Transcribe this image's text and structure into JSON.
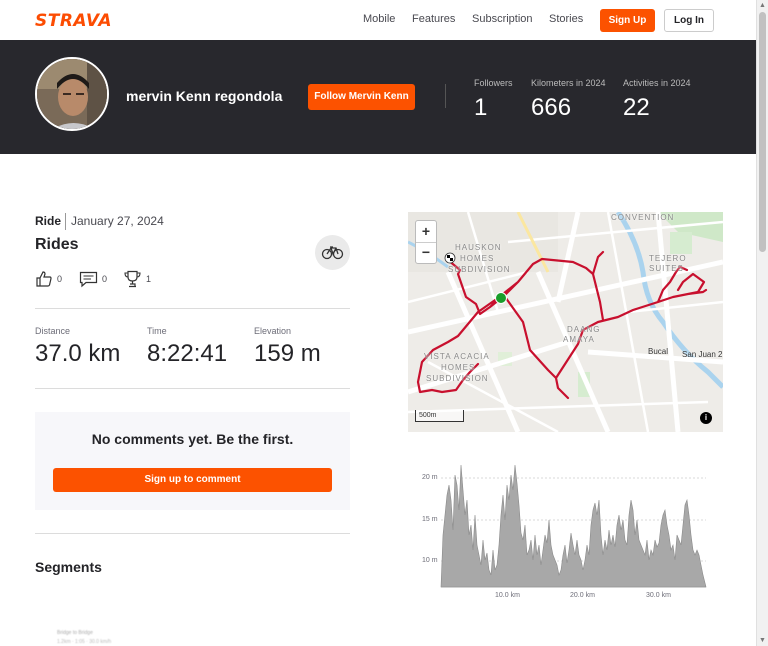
{
  "nav": {
    "logo": "STRAVA",
    "links": [
      "Mobile",
      "Features",
      "Subscription",
      "Stories"
    ],
    "signup": "Sign Up",
    "login": "Log In"
  },
  "athlete": {
    "name": "mervin Kenn regondola",
    "follow": "Follow Mervin Kenn",
    "stats": [
      {
        "label": "Followers",
        "value": "1"
      },
      {
        "label": "Kilometers in 2024",
        "value": "666"
      },
      {
        "label": "Activities in 2024",
        "value": "22"
      }
    ]
  },
  "activity": {
    "type": "Ride",
    "date": "January 27, 2024",
    "title": "Rides",
    "kudos": "0",
    "comments": "0",
    "achievements": "1",
    "metrics": [
      {
        "label": "Distance",
        "value": "37.0 km"
      },
      {
        "label": "Time",
        "value": "8:22:41"
      },
      {
        "label": "Elevation",
        "value": "159 m"
      }
    ]
  },
  "comments": {
    "empty_text": "No comments yet. Be the first.",
    "button": "Sign up to comment"
  },
  "segments": {
    "title": "Segments",
    "blurred_line1": "Bridge to Bridge",
    "blurred_line2": "1.2km · 1:05 · 30.0 km/h"
  },
  "map": {
    "zoom_in": "+",
    "zoom_out": "−",
    "scale": "500m",
    "info": "i",
    "labels": [
      "CONVENTION",
      "TEJERO",
      "SUITES",
      "HAUSKON",
      "HOMES",
      "SUBDIVISION",
      "DAANG",
      "AMAYA",
      "Bucal",
      "San Juan 2",
      "VISTA ACACIA",
      "HOMES",
      "SUBDIVISION"
    ]
  },
  "elevation": {
    "y_ticks": [
      "20 m",
      "15 m",
      "10 m"
    ],
    "x_ticks": [
      "10.0 km",
      "20.0 km",
      "30.0 km"
    ]
  },
  "colors": {
    "brand": "#fc5200",
    "header": "#28282d",
    "route": "#cc0000"
  }
}
